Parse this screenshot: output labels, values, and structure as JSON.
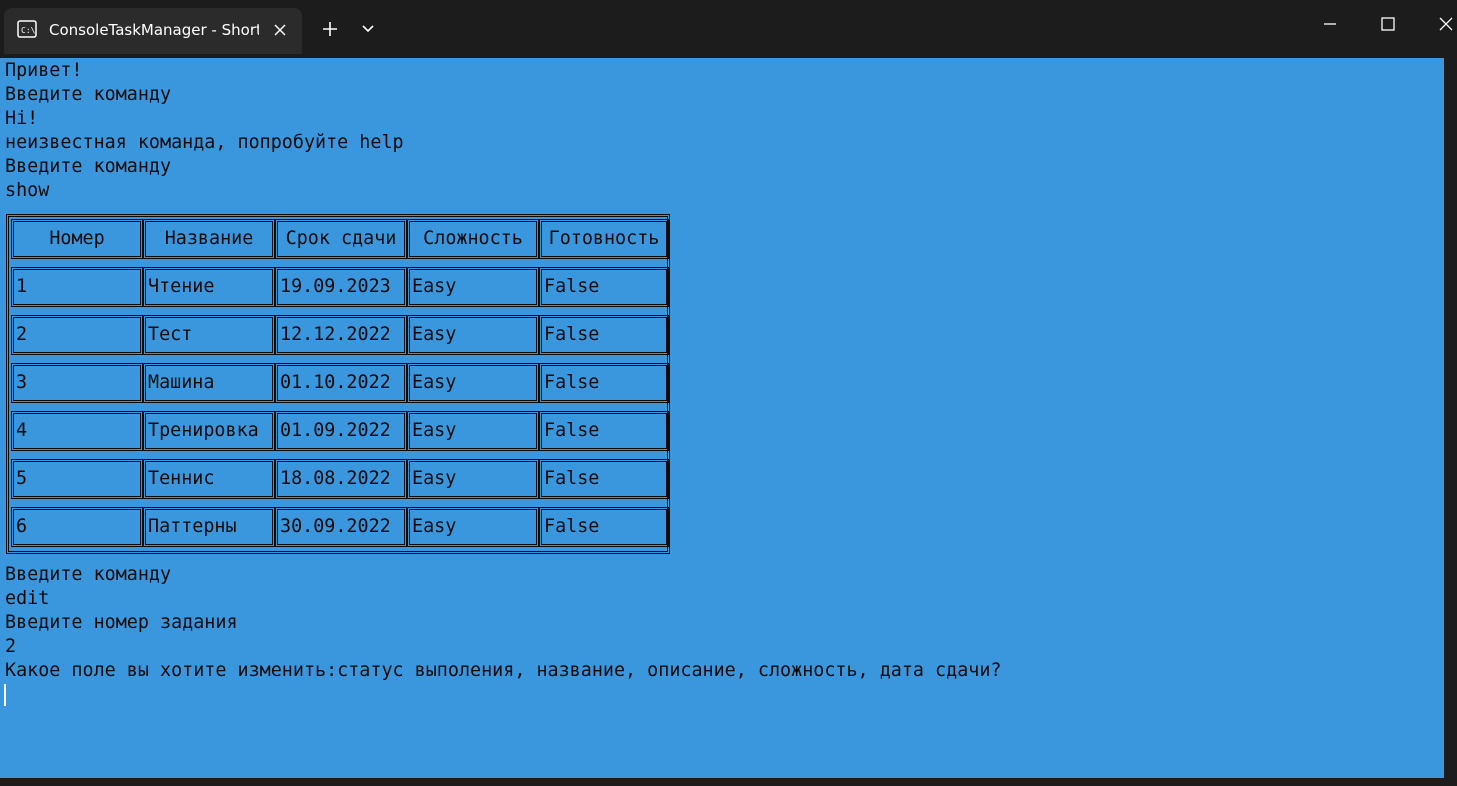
{
  "window": {
    "tab_title": "ConsoleTaskManager - Shortc",
    "icons": {
      "tab": "terminal-icon",
      "close_tab": "close-icon",
      "new_tab": "plus-icon",
      "dropdown": "chevron-down-icon",
      "minimize": "minimize-icon",
      "maximize": "maximize-icon",
      "close": "close-icon"
    }
  },
  "colors": {
    "console_background": "#3a96dd",
    "console_text": "#0c0c0c",
    "titlebar": "#1c1c1c",
    "tab": "#2b2b2b"
  },
  "console": {
    "lines_before_table": [
      "Привет!",
      "Введите команду",
      "Hi!",
      "неизвестная команда, попробуйте help",
      "Введите команду",
      "show"
    ],
    "table": {
      "headers": [
        "Номер",
        "Название",
        "Срок сдачи",
        "Сложность",
        "Готовность"
      ],
      "rows": [
        [
          "1",
          "Чтение",
          "19.09.2023",
          "Easy",
          "False"
        ],
        [
          "2",
          "Тест",
          "12.12.2022",
          "Easy",
          "False"
        ],
        [
          "3",
          "Машина",
          "01.10.2022",
          "Easy",
          "False"
        ],
        [
          "4",
          "Тренировка",
          "01.09.2022",
          "Easy",
          "False"
        ],
        [
          "5",
          "Теннис",
          "18.08.2022",
          "Easy",
          "False"
        ],
        [
          "6",
          "Паттерны",
          "30.09.2022",
          "Easy",
          "False"
        ]
      ]
    },
    "lines_after_table": [
      "Введите команду",
      "edit",
      "Введите номер задания",
      "2",
      "Какое поле вы хотите изменить:статус выполения, название, описание, сложность, дата сдачи?"
    ]
  }
}
